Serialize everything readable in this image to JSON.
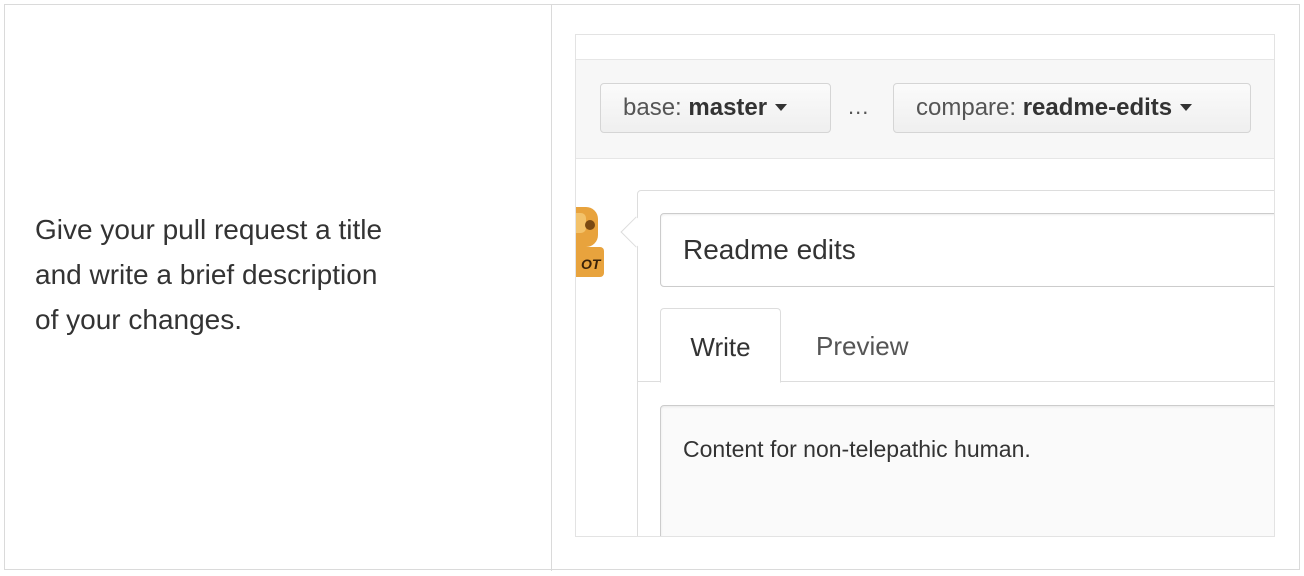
{
  "instruction": {
    "line1": "Give your pull request a title",
    "line2": "and write a brief description",
    "line3": "of your changes."
  },
  "compare_bar": {
    "base_prefix": "base: ",
    "base_branch": "master",
    "separator": "...",
    "compare_prefix": "compare: ",
    "compare_branch": "readme-edits"
  },
  "avatar": {
    "badge_text": "OT"
  },
  "form": {
    "title_value": "Readme edits",
    "tabs": [
      {
        "label": "Write",
        "active": true
      },
      {
        "label": "Preview",
        "active": false
      }
    ],
    "body_value": "Content for non-telepathic human."
  },
  "colors": {
    "text": "#333333",
    "muted_text": "#555555",
    "border": "#dddddd",
    "bar_background": "#f7f7f7",
    "avatar_accent": "#e8a33d"
  },
  "icons": {
    "dropdown": "caret-down-icon",
    "avatar": "octocat-avatar-icon"
  }
}
